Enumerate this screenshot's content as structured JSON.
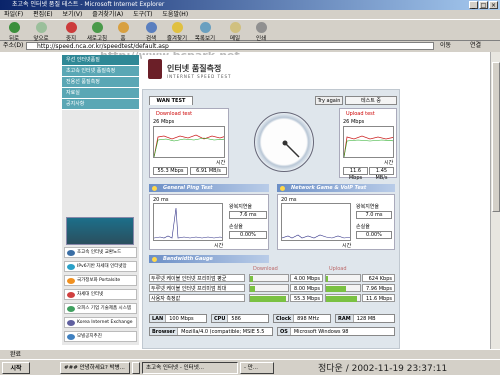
{
  "window": {
    "title": "초고속 인터넷 품질 테스트 - Microsoft Internet Explorer",
    "watermark": "http://www.bcpark.net"
  },
  "menu": [
    "파일(F)",
    "편집(E)",
    "보기(V)",
    "즐겨찾기(A)",
    "도구(T)",
    "도움말(H)"
  ],
  "toolbar": [
    "뒤로",
    "앞으로",
    "중지",
    "새로고침",
    "홈",
    "검색",
    "즐겨찾기",
    "목록보기",
    "메일",
    "인쇄"
  ],
  "address": {
    "label": "주소(D)",
    "url": "http://speed.nca.or.kr/speedtest/default.asp",
    "go": "이동",
    "links": "연결"
  },
  "nav": [
    "우선 인터넷품질",
    "초고속 인터넷 품질측정",
    "전용선 품질측정",
    "자료실",
    "공지사항"
  ],
  "banners": [
    "초고속 인터넷 교환노드",
    "IPv6기반 차세대 인터넷망",
    "국가정보화 Portalsite",
    "차세대 인터넷",
    "오피스 기업 기술제품 시스템",
    "Korea Internet Exchange",
    "모빌공지추진"
  ],
  "header": {
    "title": "인터넷 품질측정",
    "subtitle": "INTERNET SPEED TEST"
  },
  "panel": {
    "tab": "WAN TEST",
    "try_again": "Try again",
    "test_file": "테스트 중"
  },
  "download": {
    "label": "Download test",
    "scale": "26 Mbps",
    "axis": "시간",
    "mbps": "55.3 Mbps",
    "mbs": "6.91 MB/s"
  },
  "upload": {
    "label": "Upload test",
    "scale": "26 Mbps",
    "axis": "시간",
    "mbps": "11.6 Mbps",
    "mbs": "1.45 MB/s"
  },
  "ping": {
    "title": "General Ping Test",
    "scale": "20 ms",
    "axis": "시간",
    "rtt_label": "왕복지연율",
    "rtt": "7.6 ms",
    "loss_label": "손실율",
    "loss": "0.00%"
  },
  "game": {
    "title": "Network Game & VoIP Test",
    "scale": "20 ms",
    "axis": "시간",
    "rtt_label": "왕복지연율",
    "rtt": "7.0 ms",
    "loss_label": "손실율",
    "loss": "0.00%"
  },
  "bandwidth": {
    "title": "Bandwidth Gauge",
    "download_label": "Download",
    "upload_label": "Upload",
    "rows": [
      {
        "name": "두루넷 케이블 인터넷 프리미엄 평균",
        "down": "4.00 Mbps",
        "down_frac": 0.07,
        "up": "624 Kbps",
        "up_frac": 0.05
      },
      {
        "name": "두루넷 케이블 인터넷 프리미엄 최대",
        "down": "8.00 Mbps",
        "down_frac": 0.14,
        "up": "7.96 Mbps",
        "up_frac": 0.6
      },
      {
        "name": "사용자 측정값",
        "down": "55.3 Mbps",
        "down_frac": 0.95,
        "up": "11.6 Mbps",
        "up_frac": 0.9
      }
    ]
  },
  "specs": {
    "lan_label": "LAN",
    "lan": "100 Mbps",
    "cpu_label": "CPU",
    "cpu": "586",
    "clock_label": "Clock",
    "clock": "898 MHz",
    "ram_label": "RAM",
    "ram": "128 MB",
    "browser_label": "Browser",
    "browser": "Mozilla/4.0 (compatible; MSIE 5.5",
    "os_label": "OS",
    "os": "Microsoft Windows 98"
  },
  "status": "완료",
  "taskbar": {
    "start": "시작",
    "tasks": [
      "### 안녕하세요? 박병...",
      "",
      "초고속 인터넷 - 인터넷...",
      "- 만..."
    ],
    "clock": "정다운 / 2002-11-19 23:37:11"
  }
}
